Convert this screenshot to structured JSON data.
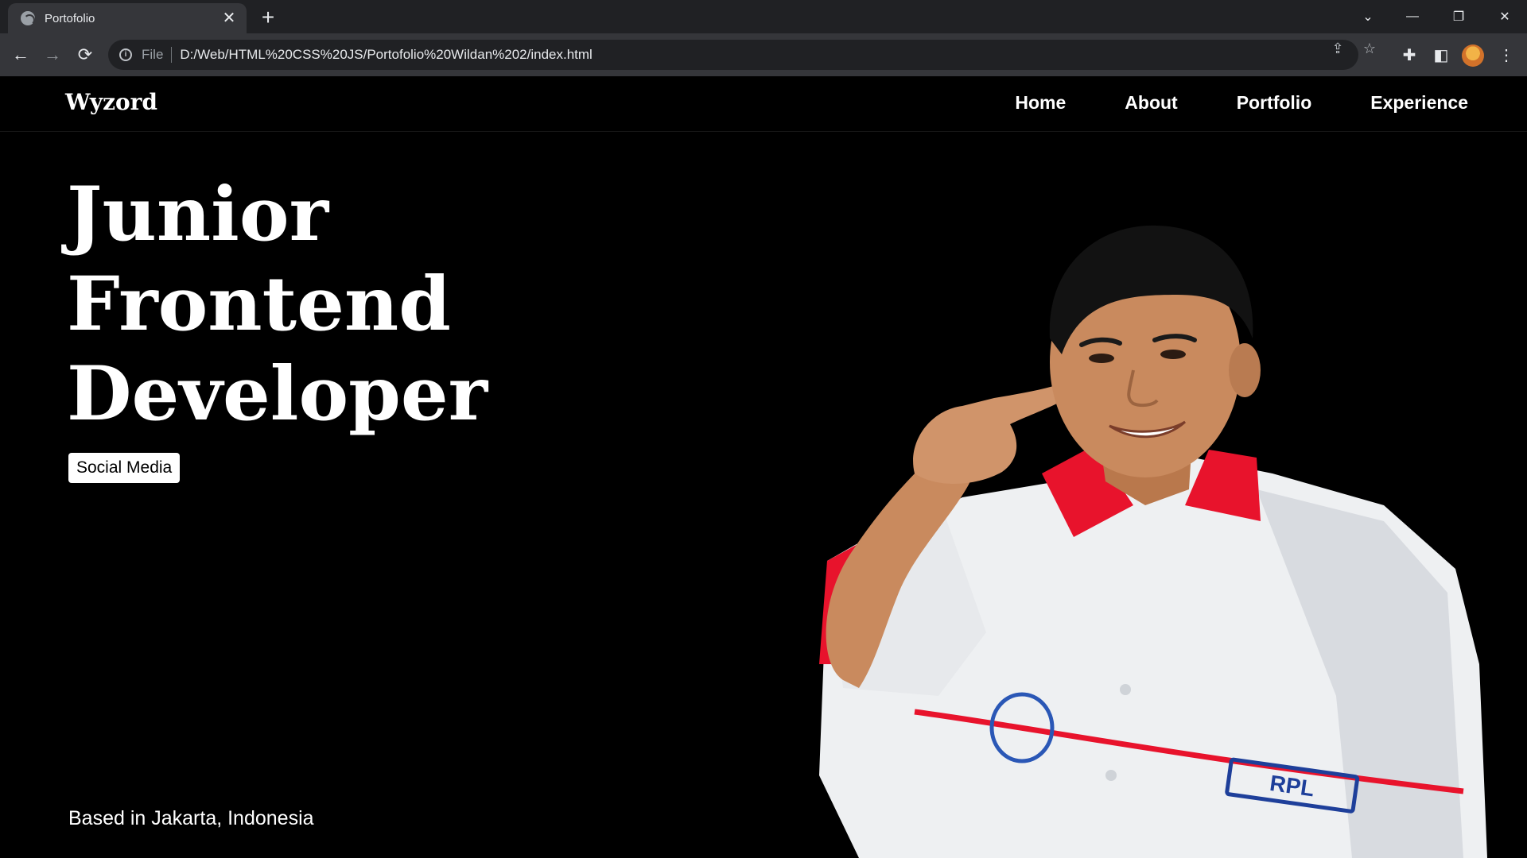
{
  "browser": {
    "tab_title": "Portofolio",
    "tab_close": "✕",
    "new_tab": "+",
    "window_controls": {
      "tab_search": "⌄",
      "minimize": "—",
      "restore": "❐",
      "close": "✕"
    },
    "scheme_label": "File",
    "url": "D:/Web/HTML%20CSS%20JS/Portofolio%20Wildan%202/index.html",
    "icons": {
      "back": "←",
      "forward": "→",
      "reload": "⟳",
      "info": "i",
      "share": "⇪",
      "bookmark": "☆",
      "extensions": "✚",
      "sidepanel": "◧",
      "menu": "⋮"
    }
  },
  "site": {
    "brand": "Wyzord",
    "nav": [
      "Home",
      "About",
      "Portfolio",
      "Experience"
    ],
    "hero_lines": [
      "Junior",
      "Frontend",
      "Developer"
    ],
    "social_button": "Social Media",
    "location": "Based in Jakarta, Indonesia",
    "photo": {
      "shirt_badge": "RPL"
    }
  },
  "colors": {
    "tabbar": "#202124",
    "toolbar": "#35363a",
    "page_bg": "#000000",
    "collar_red": "#e8132c",
    "shirt_white": "#eef0f2",
    "skin": "#c98a5e"
  }
}
